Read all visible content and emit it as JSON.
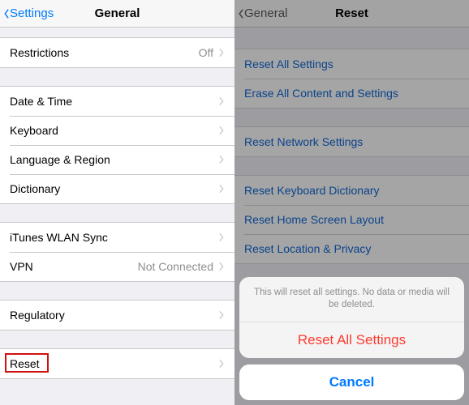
{
  "left": {
    "back_label": "Settings",
    "title": "General",
    "groups": [
      [
        {
          "label": "Restrictions",
          "value": "Off"
        }
      ],
      [
        {
          "label": "Date & Time"
        },
        {
          "label": "Keyboard"
        },
        {
          "label": "Language & Region"
        },
        {
          "label": "Dictionary"
        }
      ],
      [
        {
          "label": "iTunes WLAN Sync"
        },
        {
          "label": "VPN",
          "value": "Not Connected"
        }
      ],
      [
        {
          "label": "Regulatory"
        }
      ],
      [
        {
          "label": "Reset",
          "highlight": true
        }
      ]
    ]
  },
  "right": {
    "back_label": "General",
    "title": "Reset",
    "groups": [
      [
        {
          "label": "Reset All Settings"
        },
        {
          "label": "Erase All Content and Settings"
        }
      ],
      [
        {
          "label": "Reset Network Settings"
        }
      ],
      [
        {
          "label": "Reset Keyboard Dictionary"
        },
        {
          "label": "Reset Home Screen Layout"
        },
        {
          "label": "Reset Location & Privacy"
        }
      ]
    ],
    "sheet": {
      "message": "This will reset all settings. No data or media will be deleted.",
      "destructive": "Reset All Settings",
      "cancel": "Cancel"
    }
  }
}
